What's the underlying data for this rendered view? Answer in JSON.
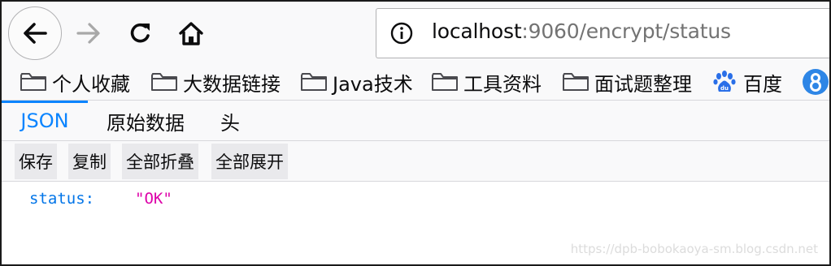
{
  "nav": {
    "back_icon": "arrow-left-icon",
    "forward_icon": "arrow-right-icon",
    "reload_icon": "reload-icon",
    "home_icon": "home-icon",
    "url_host": "localhost",
    "url_rest": ":9060/encrypt/status"
  },
  "bookmarks": {
    "items": [
      {
        "label": "个人收藏",
        "icon": "folder-icon"
      },
      {
        "label": "大数据链接",
        "icon": "folder-icon"
      },
      {
        "label": "Java技术",
        "icon": "folder-icon"
      },
      {
        "label": "工具资料",
        "icon": "folder-icon"
      },
      {
        "label": "面试题整理",
        "icon": "folder-icon"
      },
      {
        "label": "百度",
        "icon": "baidu-paw-icon"
      }
    ],
    "overflow_icon": "circle-badge-icon"
  },
  "viewer": {
    "tabs": [
      {
        "label": "JSON",
        "active": true
      },
      {
        "label": "原始数据",
        "active": false
      },
      {
        "label": "头",
        "active": false
      }
    ],
    "actions": [
      {
        "label": "保存"
      },
      {
        "label": "复制"
      },
      {
        "label": "全部折叠"
      },
      {
        "label": "全部展开"
      }
    ]
  },
  "json_body": {
    "key": "status:",
    "value": "\"OK\""
  },
  "watermark": "https://dpb-bobokaoya-sm.blog.csdn.net",
  "colors": {
    "accent": "#0a84ff",
    "json_key": "#0074e8",
    "json_string": "#dd00a9",
    "toolbar_bg": "#f9f9fa"
  }
}
